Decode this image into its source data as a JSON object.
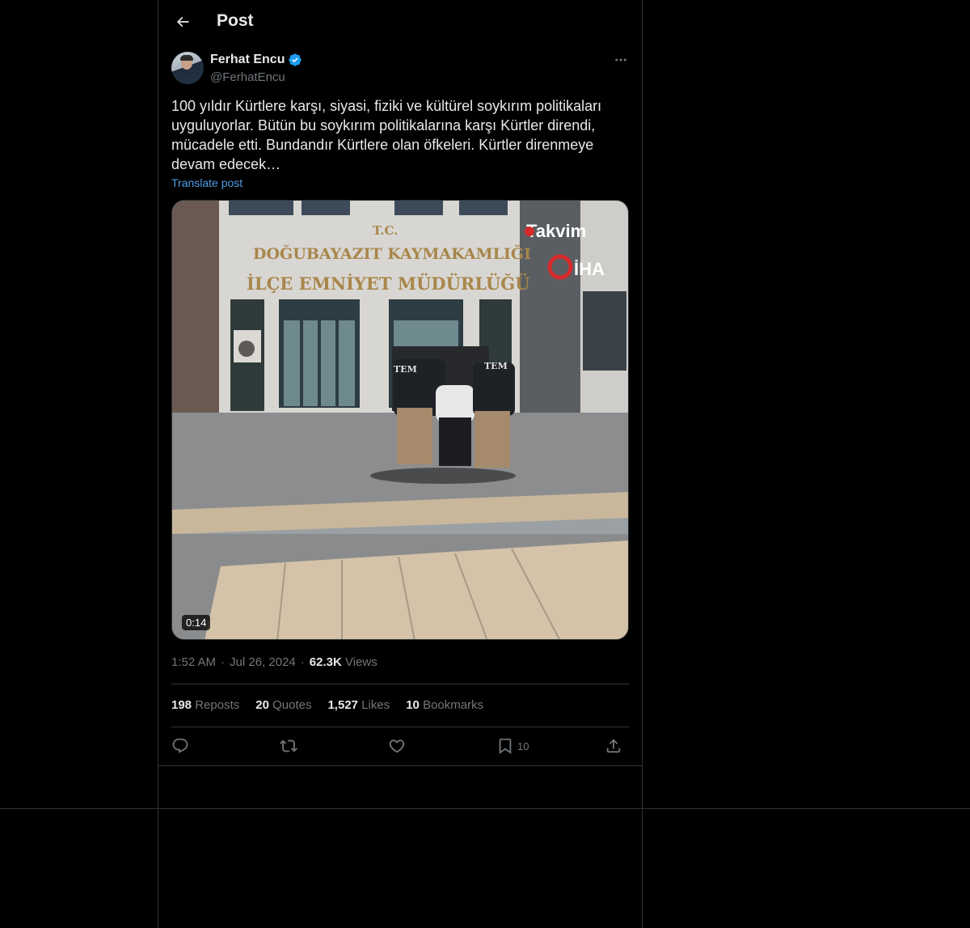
{
  "header": {
    "title": "Post",
    "back_icon": "arrow-left-icon"
  },
  "author": {
    "name": "Ferhat Encu",
    "handle": "@FerhatEncu",
    "verified_icon": "verified-badge-icon",
    "verified_color": "#1d9bf0"
  },
  "post": {
    "text": "100 yıldır Kürtlere karşı, siyasi, fiziki ve kültürel soykırım politikaları\nuyguluyorlar. Bütün bu soykırım politikalarına karşı Kürtler direndi,\nmücadele etti. Bundandır Kürtlere olan öfkeleri. Kürtler direnmeye\ndevam edecek…",
    "translate_label": "Translate post"
  },
  "media": {
    "type": "video",
    "duration": "0:14",
    "sign_line1": "T.C.",
    "sign_line2": "DOĞUBAYAZIT KAYMAKAMLIĞI",
    "sign_line3": "İLÇE EMNİYET MÜDÜRLÜĞÜ",
    "watermark1": "Takvim",
    "watermark2": "İHA",
    "jacket_text": "TEM"
  },
  "meta": {
    "time": "1:52 AM",
    "date": "Jul 26, 2024",
    "views_count": "62.3K",
    "views_label": "Views",
    "separator": "·"
  },
  "stats": {
    "reposts_count": "198",
    "reposts_label": "Reposts",
    "quotes_count": "20",
    "quotes_label": "Quotes",
    "likes_count": "1,527",
    "likes_label": "Likes",
    "bookmarks_count": "10",
    "bookmarks_label": "Bookmarks"
  },
  "actions": {
    "reply_icon": "reply-icon",
    "repost_icon": "repost-icon",
    "like_icon": "heart-icon",
    "bookmark_icon": "bookmark-icon",
    "bookmark_count": "10",
    "share_icon": "share-icon"
  },
  "colors": {
    "background": "#000000",
    "text": "#e7e9ea",
    "muted": "#71767b",
    "link": "#4e9ee8",
    "border": "#2f3336"
  }
}
